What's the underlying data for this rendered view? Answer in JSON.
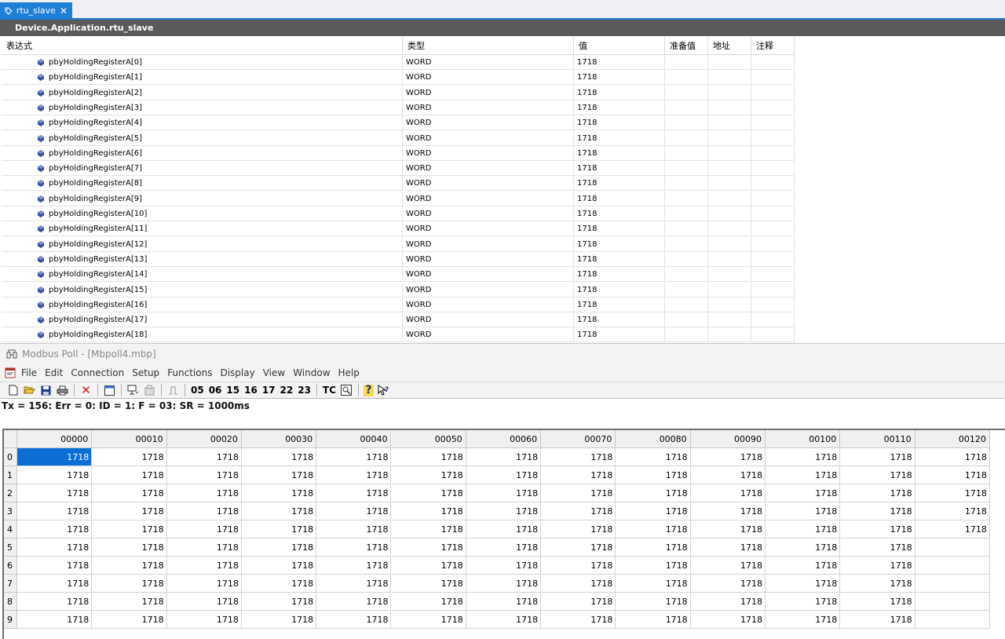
{
  "editor": {
    "tab_label": "rtu_slave",
    "path": "Device.Application.rtu_slave",
    "columns": [
      "表达式",
      "类型",
      "值",
      "准备值",
      "地址",
      "注释"
    ],
    "rows": [
      {
        "expr": "pbyHoldingRegisterA[0]",
        "type": "WORD",
        "value": "1718"
      },
      {
        "expr": "pbyHoldingRegisterA[1]",
        "type": "WORD",
        "value": "1718"
      },
      {
        "expr": "pbyHoldingRegisterA[2]",
        "type": "WORD",
        "value": "1718"
      },
      {
        "expr": "pbyHoldingRegisterA[3]",
        "type": "WORD",
        "value": "1718"
      },
      {
        "expr": "pbyHoldingRegisterA[4]",
        "type": "WORD",
        "value": "1718"
      },
      {
        "expr": "pbyHoldingRegisterA[5]",
        "type": "WORD",
        "value": "1718"
      },
      {
        "expr": "pbyHoldingRegisterA[6]",
        "type": "WORD",
        "value": "1718"
      },
      {
        "expr": "pbyHoldingRegisterA[7]",
        "type": "WORD",
        "value": "1718"
      },
      {
        "expr": "pbyHoldingRegisterA[8]",
        "type": "WORD",
        "value": "1718"
      },
      {
        "expr": "pbyHoldingRegisterA[9]",
        "type": "WORD",
        "value": "1718"
      },
      {
        "expr": "pbyHoldingRegisterA[10]",
        "type": "WORD",
        "value": "1718"
      },
      {
        "expr": "pbyHoldingRegisterA[11]",
        "type": "WORD",
        "value": "1718"
      },
      {
        "expr": "pbyHoldingRegisterA[12]",
        "type": "WORD",
        "value": "1718"
      },
      {
        "expr": "pbyHoldingRegisterA[13]",
        "type": "WORD",
        "value": "1718"
      },
      {
        "expr": "pbyHoldingRegisterA[14]",
        "type": "WORD",
        "value": "1718"
      },
      {
        "expr": "pbyHoldingRegisterA[15]",
        "type": "WORD",
        "value": "1718"
      },
      {
        "expr": "pbyHoldingRegisterA[16]",
        "type": "WORD",
        "value": "1718"
      },
      {
        "expr": "pbyHoldingRegisterA[17]",
        "type": "WORD",
        "value": "1718"
      },
      {
        "expr": "pbyHoldingRegisterA[18]",
        "type": "WORD",
        "value": "1718"
      }
    ]
  },
  "modbus": {
    "title": "Modbus Poll - [Mbpoll4.mbp]",
    "menu": [
      "File",
      "Edit",
      "Connection",
      "Setup",
      "Functions",
      "Display",
      "View",
      "Window",
      "Help"
    ],
    "toolbar_codes": [
      "05",
      "06",
      "15",
      "16",
      "17",
      "22",
      "23"
    ],
    "toolbar_tc": "TC",
    "status": "Tx = 156: Err = 0: ID = 1: F = 03: SR = 1000ms",
    "col_headers": [
      "00000",
      "00010",
      "00020",
      "00030",
      "00040",
      "00050",
      "00060",
      "00070",
      "00080",
      "00090",
      "00100",
      "00110",
      "00120"
    ],
    "row_headers": [
      "0",
      "1",
      "2",
      "3",
      "4",
      "5",
      "6",
      "7",
      "8",
      "9"
    ],
    "cells": [
      [
        "1718",
        "1718",
        "1718",
        "1718",
        "1718",
        "1718",
        "1718",
        "1718",
        "1718",
        "1718",
        "1718",
        "1718",
        "1718"
      ],
      [
        "1718",
        "1718",
        "1718",
        "1718",
        "1718",
        "1718",
        "1718",
        "1718",
        "1718",
        "1718",
        "1718",
        "1718",
        "1718"
      ],
      [
        "1718",
        "1718",
        "1718",
        "1718",
        "1718",
        "1718",
        "1718",
        "1718",
        "1718",
        "1718",
        "1718",
        "1718",
        "1718"
      ],
      [
        "1718",
        "1718",
        "1718",
        "1718",
        "1718",
        "1718",
        "1718",
        "1718",
        "1718",
        "1718",
        "1718",
        "1718",
        "1718"
      ],
      [
        "1718",
        "1718",
        "1718",
        "1718",
        "1718",
        "1718",
        "1718",
        "1718",
        "1718",
        "1718",
        "1718",
        "1718",
        "1718"
      ],
      [
        "1718",
        "1718",
        "1718",
        "1718",
        "1718",
        "1718",
        "1718",
        "1718",
        "1718",
        "1718",
        "1718",
        "1718",
        ""
      ],
      [
        "1718",
        "1718",
        "1718",
        "1718",
        "1718",
        "1718",
        "1718",
        "1718",
        "1718",
        "1718",
        "1718",
        "1718",
        ""
      ],
      [
        "1718",
        "1718",
        "1718",
        "1718",
        "1718",
        "1718",
        "1718",
        "1718",
        "1718",
        "1718",
        "1718",
        "1718",
        ""
      ],
      [
        "1718",
        "1718",
        "1718",
        "1718",
        "1718",
        "1718",
        "1718",
        "1718",
        "1718",
        "1718",
        "1718",
        "1718",
        ""
      ],
      [
        "1718",
        "1718",
        "1718",
        "1718",
        "1718",
        "1718",
        "1718",
        "1718",
        "1718",
        "1718",
        "1718",
        "1718",
        ""
      ]
    ],
    "selected_color": "#0a6ed6"
  },
  "icons": {
    "tab": "tag-icon",
    "variable": "variable-icon",
    "app": "modbus-poll-icon",
    "doc": "document-icon"
  }
}
